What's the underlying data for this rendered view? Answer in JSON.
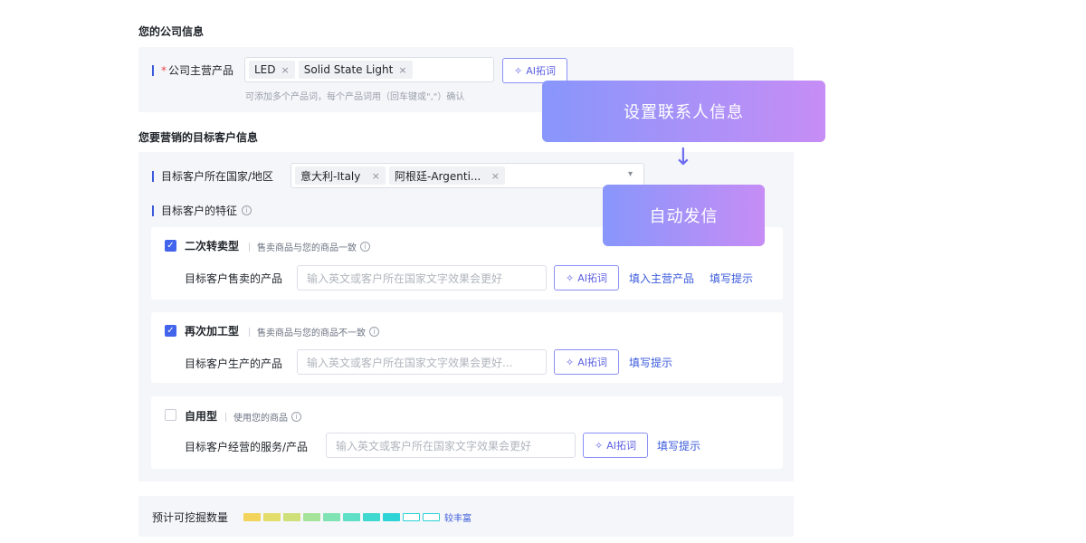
{
  "company": {
    "section_title": "您的公司信息",
    "required_mark": "*",
    "main_product_label": "公司主营产品",
    "tags": [
      {
        "label": "LED",
        "remove": "×"
      },
      {
        "label": "Solid State Light",
        "remove": "×"
      }
    ],
    "ai_button": "AI拓词",
    "hint": "可添加多个产品词，每个产品词用（回车键或\",\"）确认"
  },
  "target": {
    "section_title": "您要营销的目标客户信息",
    "country_label": "目标客户所在国家/地区",
    "countries": [
      {
        "label": "意大利-Italy",
        "remove": "×"
      },
      {
        "label": "阿根廷-Argenti...",
        "remove": "×"
      }
    ],
    "dropdown_caret": "▾",
    "features_label": "目标客户的特征",
    "info_glyph": "i",
    "types": [
      {
        "checked": true,
        "name": "二次转卖型",
        "desc": "售卖商品与您的商品一致",
        "row_label": "目标客户售卖的产品",
        "placeholder": "输入英文或客户所在国家文字效果会更好",
        "ai_button": "AI拓词",
        "links": [
          "填入主营产品",
          "填写提示"
        ]
      },
      {
        "checked": true,
        "name": "再次加工型",
        "desc": "售卖商品与您的商品不一致",
        "row_label": "目标客户生产的产品",
        "placeholder": "输入英文或客户所在国家文字效果会更好...",
        "ai_button": "AI拓词",
        "links": [
          "填写提示"
        ]
      },
      {
        "checked": false,
        "name": "自用型",
        "desc": "使用您的商品",
        "row_label": "目标客户经营的服务/产品",
        "placeholder": "输入英文或客户所在国家文字效果会更好",
        "ai_button": "AI拓词",
        "links": [
          "填写提示"
        ]
      }
    ]
  },
  "estimate": {
    "label": "预计可挖掘数量",
    "level_text": "较丰富",
    "segments_total": 10,
    "segments_filled": 8,
    "segment_colors": [
      "#f2d45c",
      "#e3de6b",
      "#cfe07a",
      "#a6e39a",
      "#7fe3b3",
      "#5fe0c6",
      "#3fd9cf",
      "#2ed3d6"
    ]
  },
  "flow": {
    "step1": "设置联系人信息",
    "step2": "自动发信",
    "arrow": "↓"
  },
  "theme": {
    "accent": "#4263eb",
    "gradient_start": "#8896fb",
    "gradient_end": "#c68df5"
  }
}
